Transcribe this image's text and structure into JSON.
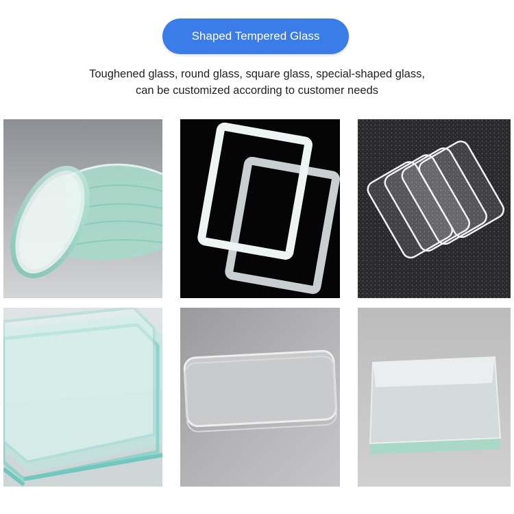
{
  "header": {
    "badge_label": "Shaped Tempered Glass",
    "badge_color": "#3b7de8"
  },
  "description": {
    "line1": "Toughened glass, round glass, square glass, special-shaped glass,",
    "line2": "can be customized according to customer needs"
  },
  "gallery": {
    "photos": [
      {
        "subject": "round glass discs stack"
      },
      {
        "subject": "frosted-edge rectangular glass frames"
      },
      {
        "subject": "rounded-corner clear glass sheets"
      },
      {
        "subject": "stacked square tempered glass panels"
      },
      {
        "subject": "rounded rectangle glass plate"
      },
      {
        "subject": "thick rectangular glass plate"
      }
    ]
  }
}
